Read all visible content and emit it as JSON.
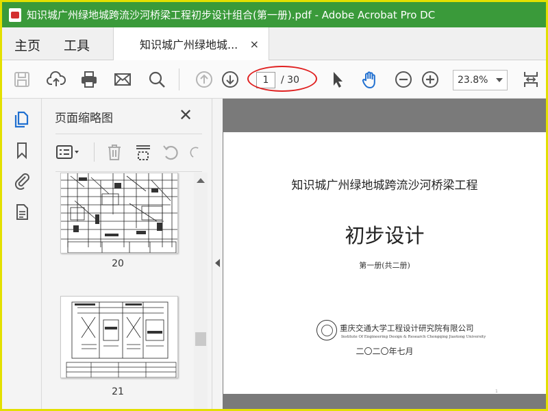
{
  "window": {
    "title": "知识城广州绿地城跨流沙河桥梁工程初步设计组合(第一册).pdf - Adobe Acrobat Pro DC"
  },
  "nav": {
    "home": "主页",
    "tools": "工具"
  },
  "doc_tab": {
    "title": "知识城广州绿地城...",
    "close": "×"
  },
  "toolbar": {
    "save_icon": "save-icon",
    "upload_icon": "cloud-upload-icon",
    "print_icon": "printer-icon",
    "email_icon": "mail-icon",
    "search_icon": "search-icon",
    "prev_icon": "arrow-up-circle-icon",
    "next_icon": "arrow-down-circle-icon",
    "current_page": "1",
    "total_pages": "/ 30",
    "select_icon": "cursor-icon",
    "hand_icon": "hand-icon",
    "zoom_out_icon": "zoom-out-icon",
    "zoom_in_icon": "zoom-in-icon",
    "zoom_value": "23.8%",
    "fit_icon": "fit-page-icon"
  },
  "colors": {
    "titlebar": "#3a9a3a",
    "frame_border": "#e3e000",
    "accent_blue": "#1f6fd0",
    "annotation_red": "#e02020"
  },
  "sidebar_rail": [
    "page-thumbnails-icon",
    "bookmark-icon",
    "attachment-icon",
    "document-properties-icon"
  ],
  "panel": {
    "title": "页面缩略图",
    "close": "✕",
    "tools": [
      "thumbnail-options-icon",
      "delete-icon",
      "extract-icon",
      "rotate-ccw-icon",
      "rotate-cw-icon"
    ],
    "thumbnails": [
      {
        "label": "20"
      },
      {
        "label": "21"
      }
    ]
  },
  "document": {
    "project_name": "知识城广州绿地城跨流沙河桥梁工程",
    "main_title": "初步设计",
    "volume": "第一册(共二册)",
    "company": "重庆交通大学工程设计研究院有限公司",
    "company_en": "Institute Of Engineering Design & Research Chongqing Jiaotong University",
    "date": "二〇二〇年七月",
    "page_mark": "1"
  }
}
